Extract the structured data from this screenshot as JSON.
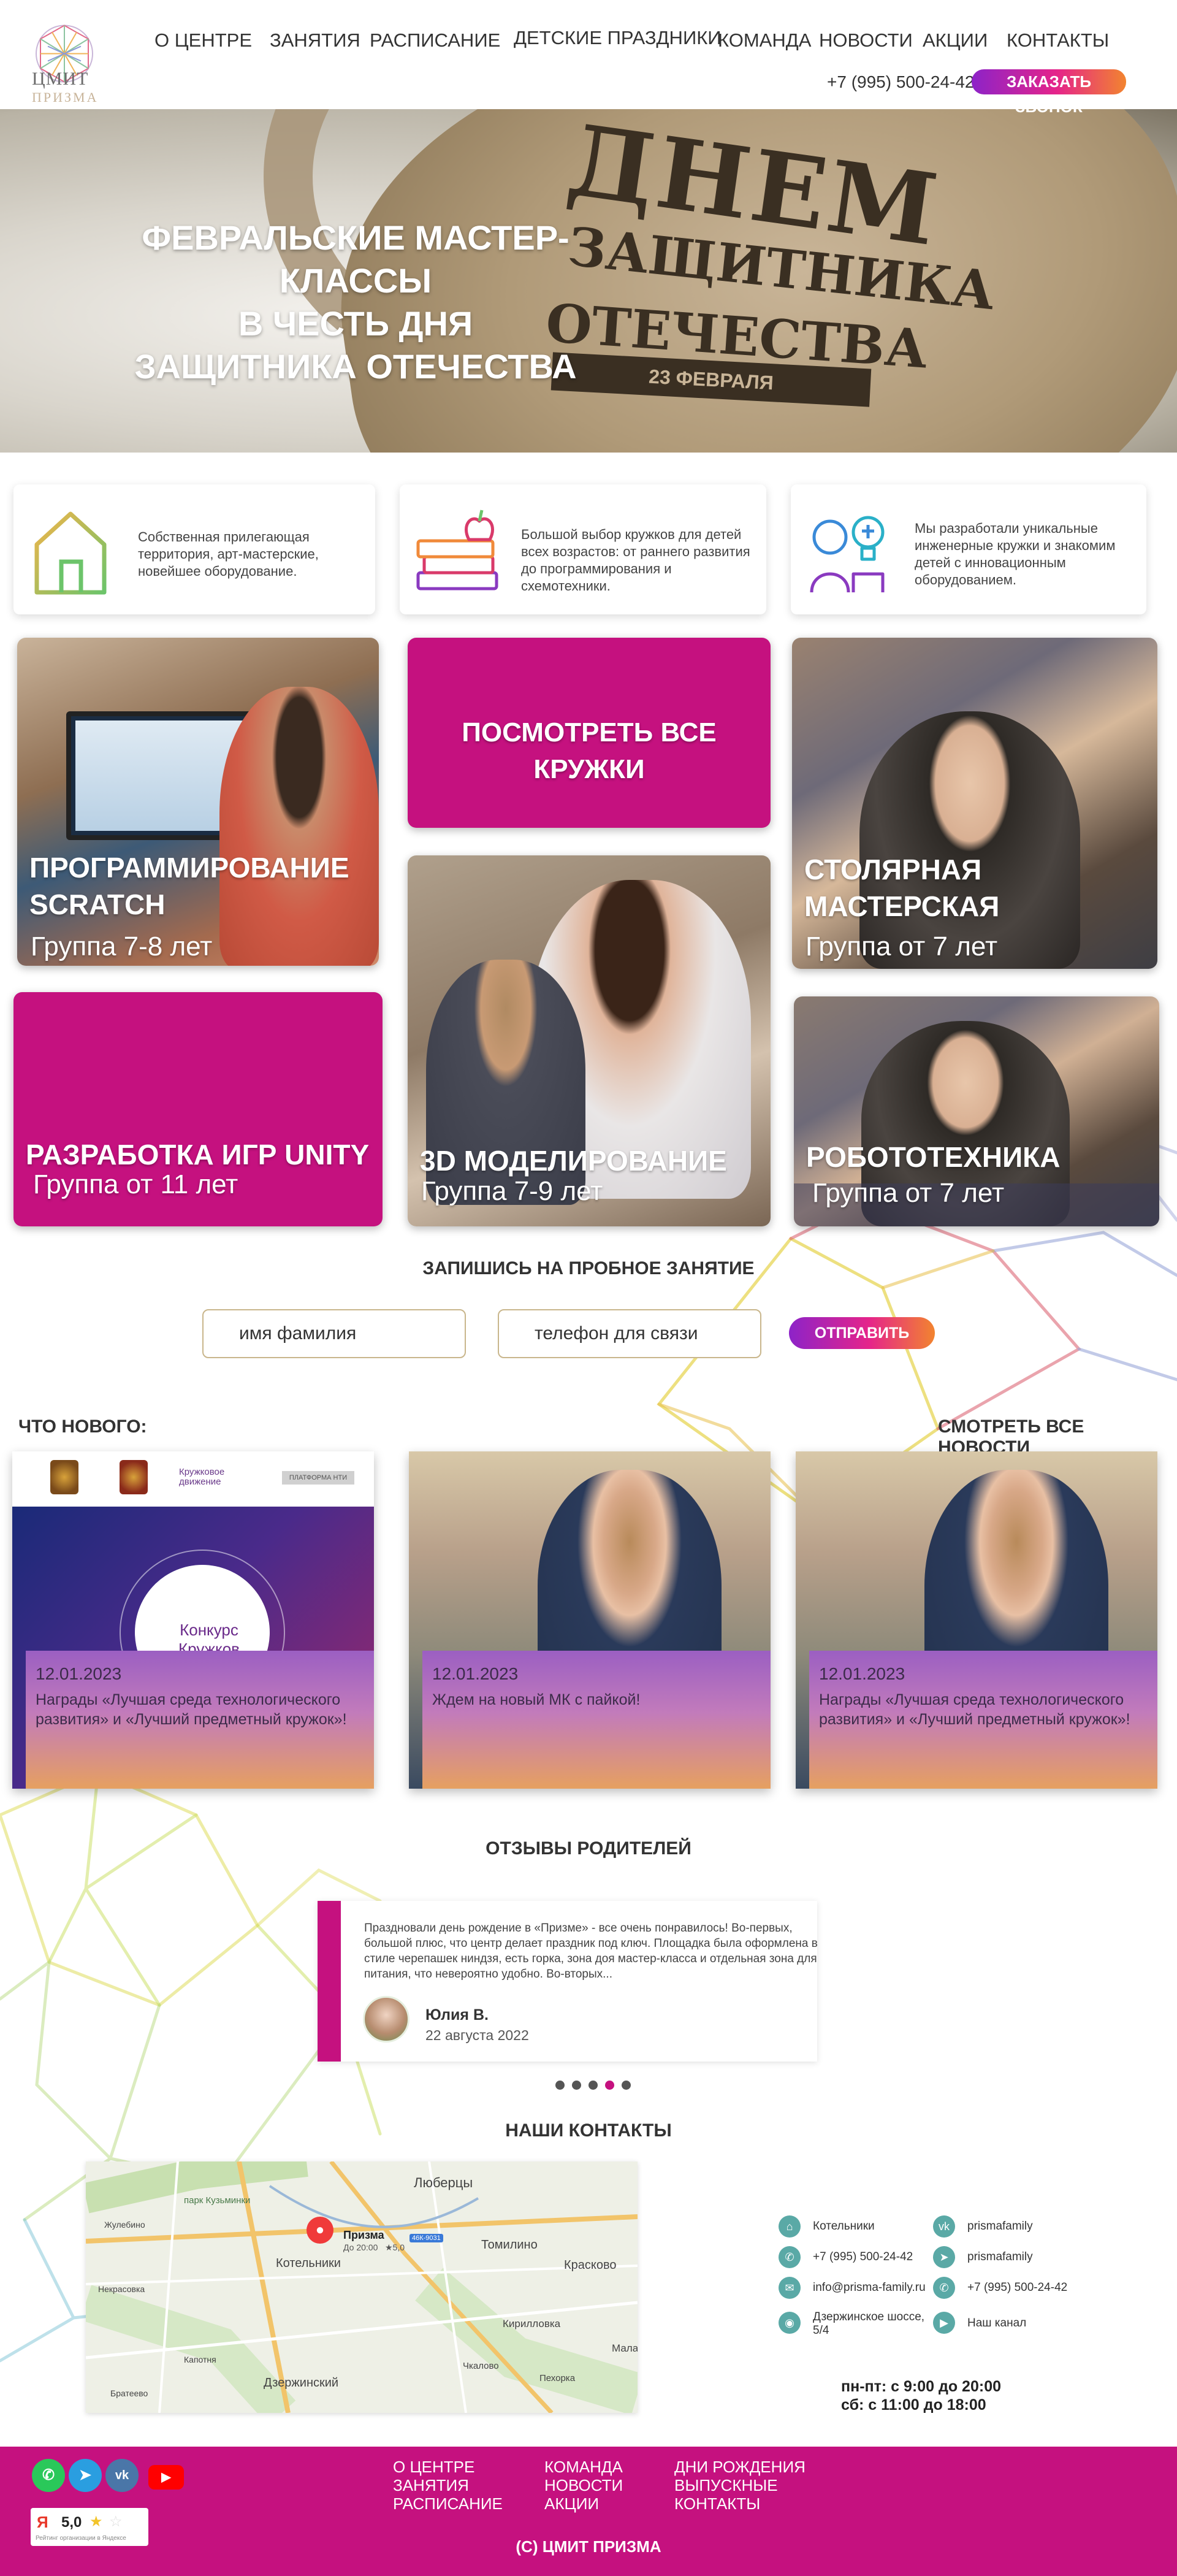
{
  "header": {
    "logo_line1": "ЦМИТ",
    "logo_line2": "ПРИЗМА",
    "nav": [
      "О ЦЕНТРЕ",
      "ЗАНЯТИЯ",
      "РАСПИСАНИЕ",
      "ДЕТСКИЕ ПРАЗДНИКИ",
      "КОМАНДА",
      "НОВОСТИ",
      "АКЦИИ",
      "КОНТАКТЫ"
    ],
    "phone": "+7 (995) 500-24-42",
    "call_button": "ЗАКАЗАТЬ ЗВОНОК"
  },
  "hero": {
    "title": "ФЕВРАЛЬСКИЕ МАСТЕР-КЛАССЫ\nВ ЧЕСТЬ ДНЯ\nЗАЩИТНИКА ОТЕЧЕСТВА",
    "badge_big": "ДНЕМ",
    "badge_line2": "ЗАЩИТНИКА",
    "badge_line3": "ОТЕЧЕСТВА",
    "badge_date": "23 ФЕВРАЛЯ"
  },
  "features": [
    {
      "text": "Собственная прилегающая территория, арт-мастерские, новейшее оборудование.",
      "icon": "house-icon"
    },
    {
      "text": "Большой выбор кружков для детей всех возрастов: от раннего развития до программирования и схемотехники.",
      "icon": "books-icon"
    },
    {
      "text": "Мы разработали уникальные инженерные кружки и знакомим детей с инновационным оборудованием.",
      "icon": "engineer-icon"
    }
  ],
  "cards": {
    "scratch": {
      "title": "ПРОГРАММИРОВАНИЕ SCRATCH",
      "sub": "Группа 7-8 лет"
    },
    "all": {
      "title": "ПОСМОТРЕТЬ ВСЕ КРУЖКИ"
    },
    "carpentry": {
      "title": "СТОЛЯРНАЯ МАСТЕРСКАЯ",
      "sub": "Группа от 7 лет"
    },
    "unity": {
      "title": "РАЗРАБОТКА ИГР UNITY",
      "sub": "Группа от 11 лет"
    },
    "modeling": {
      "title": "3D МОДЕЛИРОВАНИЕ",
      "sub": "Группа 7-9 лет"
    },
    "robotics": {
      "title": "РОБОТОТЕХНИКА",
      "sub": "Группа от 7 лет"
    }
  },
  "form": {
    "title": "ЗАПИШИСЬ НА ПРОБНОЕ ЗАНЯТИЕ",
    "name_placeholder": "имя фамилия",
    "phone_placeholder": "телефон для связи",
    "submit": "ОТПРАВИТЬ"
  },
  "news": {
    "heading": "ЧТО НОВОГО:",
    "all_link": "СМОТРЕТЬ ВСЕ НОВОСТИ",
    "contest_label": "Конкурс Кружков",
    "kruzhk_label": "Кружковое движение",
    "platform_label": "ПЛАТФОРМА НТИ",
    "items": [
      {
        "date": "12.01.2023",
        "text": "Награды «Лучшая среда технологического развития» и «Лучший  предметный кружок»!"
      },
      {
        "date": "12.01.2023",
        "text": "Ждем на новый МК с пайкой!"
      },
      {
        "date": "12.01.2023",
        "text": "Награды «Лучшая среда технологического развития» и  «Лучший  предметный кружок»!"
      }
    ]
  },
  "reviews": {
    "heading": "ОТЗЫВЫ РОДИТЕЛЕЙ",
    "text": "Праздновали день рождение в «Призме»  - все очень понравилось! Во-первых, большой плюс, что центр делает праздник под ключ. Площадка была оформлена в стиле  черепашек ниндзя, есть горка, зона доя мастер-класса и отдельная зона для питания, что невероятно удобно. Во-вторых...",
    "name": "Юлия В.",
    "date": "22 августа 2022",
    "dots": 5,
    "active_dot": 3
  },
  "contacts": {
    "heading": "НАШИ КОНТАКТЫ",
    "map": {
      "place_name": "Призма",
      "place_hours": "До 20:00",
      "place_rating": "★5,0",
      "labels": [
        "Люберцы",
        "Котельники",
        "Томилино",
        "Красково",
        "Кирилловка",
        "Дзержинский",
        "парк Кузьминки",
        "Малах",
        "Чкалово",
        "Пехорка",
        "Жулебино",
        "Капотня",
        "Некрасовка",
        "Братеево"
      ],
      "road_badge": "46К-9031"
    },
    "left": [
      {
        "icon": "pin-icon",
        "text": "Котельники"
      },
      {
        "icon": "phone-icon",
        "text": "+7 (995) 500-24-42"
      },
      {
        "icon": "mail-icon",
        "text": "info@prisma-family.ru"
      },
      {
        "icon": "location-icon",
        "text": "Дзержинское шоссе, 5/4"
      }
    ],
    "right": [
      {
        "icon": "vk-icon",
        "text": "prismafamily"
      },
      {
        "icon": "telegram-icon",
        "text": "prismafamily"
      },
      {
        "icon": "whatsapp-icon",
        "text": "+7 (995) 500-24-42"
      },
      {
        "icon": "youtube-icon",
        "text": "Наш канал"
      }
    ],
    "hours_1": "пн-пт: с 9:00 до 20:00",
    "hours_2": "сб: с 11:00 до 18:00"
  },
  "footer": {
    "col1": [
      "О ЦЕНТРЕ",
      "ЗАНЯТИЯ",
      "РАСПИСАНИЕ"
    ],
    "col2": [
      "КОМАНДА",
      "НОВОСТИ",
      "АКЦИИ"
    ],
    "col3": [
      "ДНИ РОЖДЕНИЯ",
      "ВЫПУСКНЫЕ",
      "КОНТАКТЫ"
    ],
    "rating": "5,0",
    "rating_caption": "Рейтинг организации в Яндексе",
    "copyright": "(С) ЦМИТ ПРИЗМА"
  },
  "colors": {
    "accent": "#c5117f",
    "teal": "#5aa9a6",
    "gradient_start": "#8d23c8",
    "gradient_end": "#f2842f"
  }
}
